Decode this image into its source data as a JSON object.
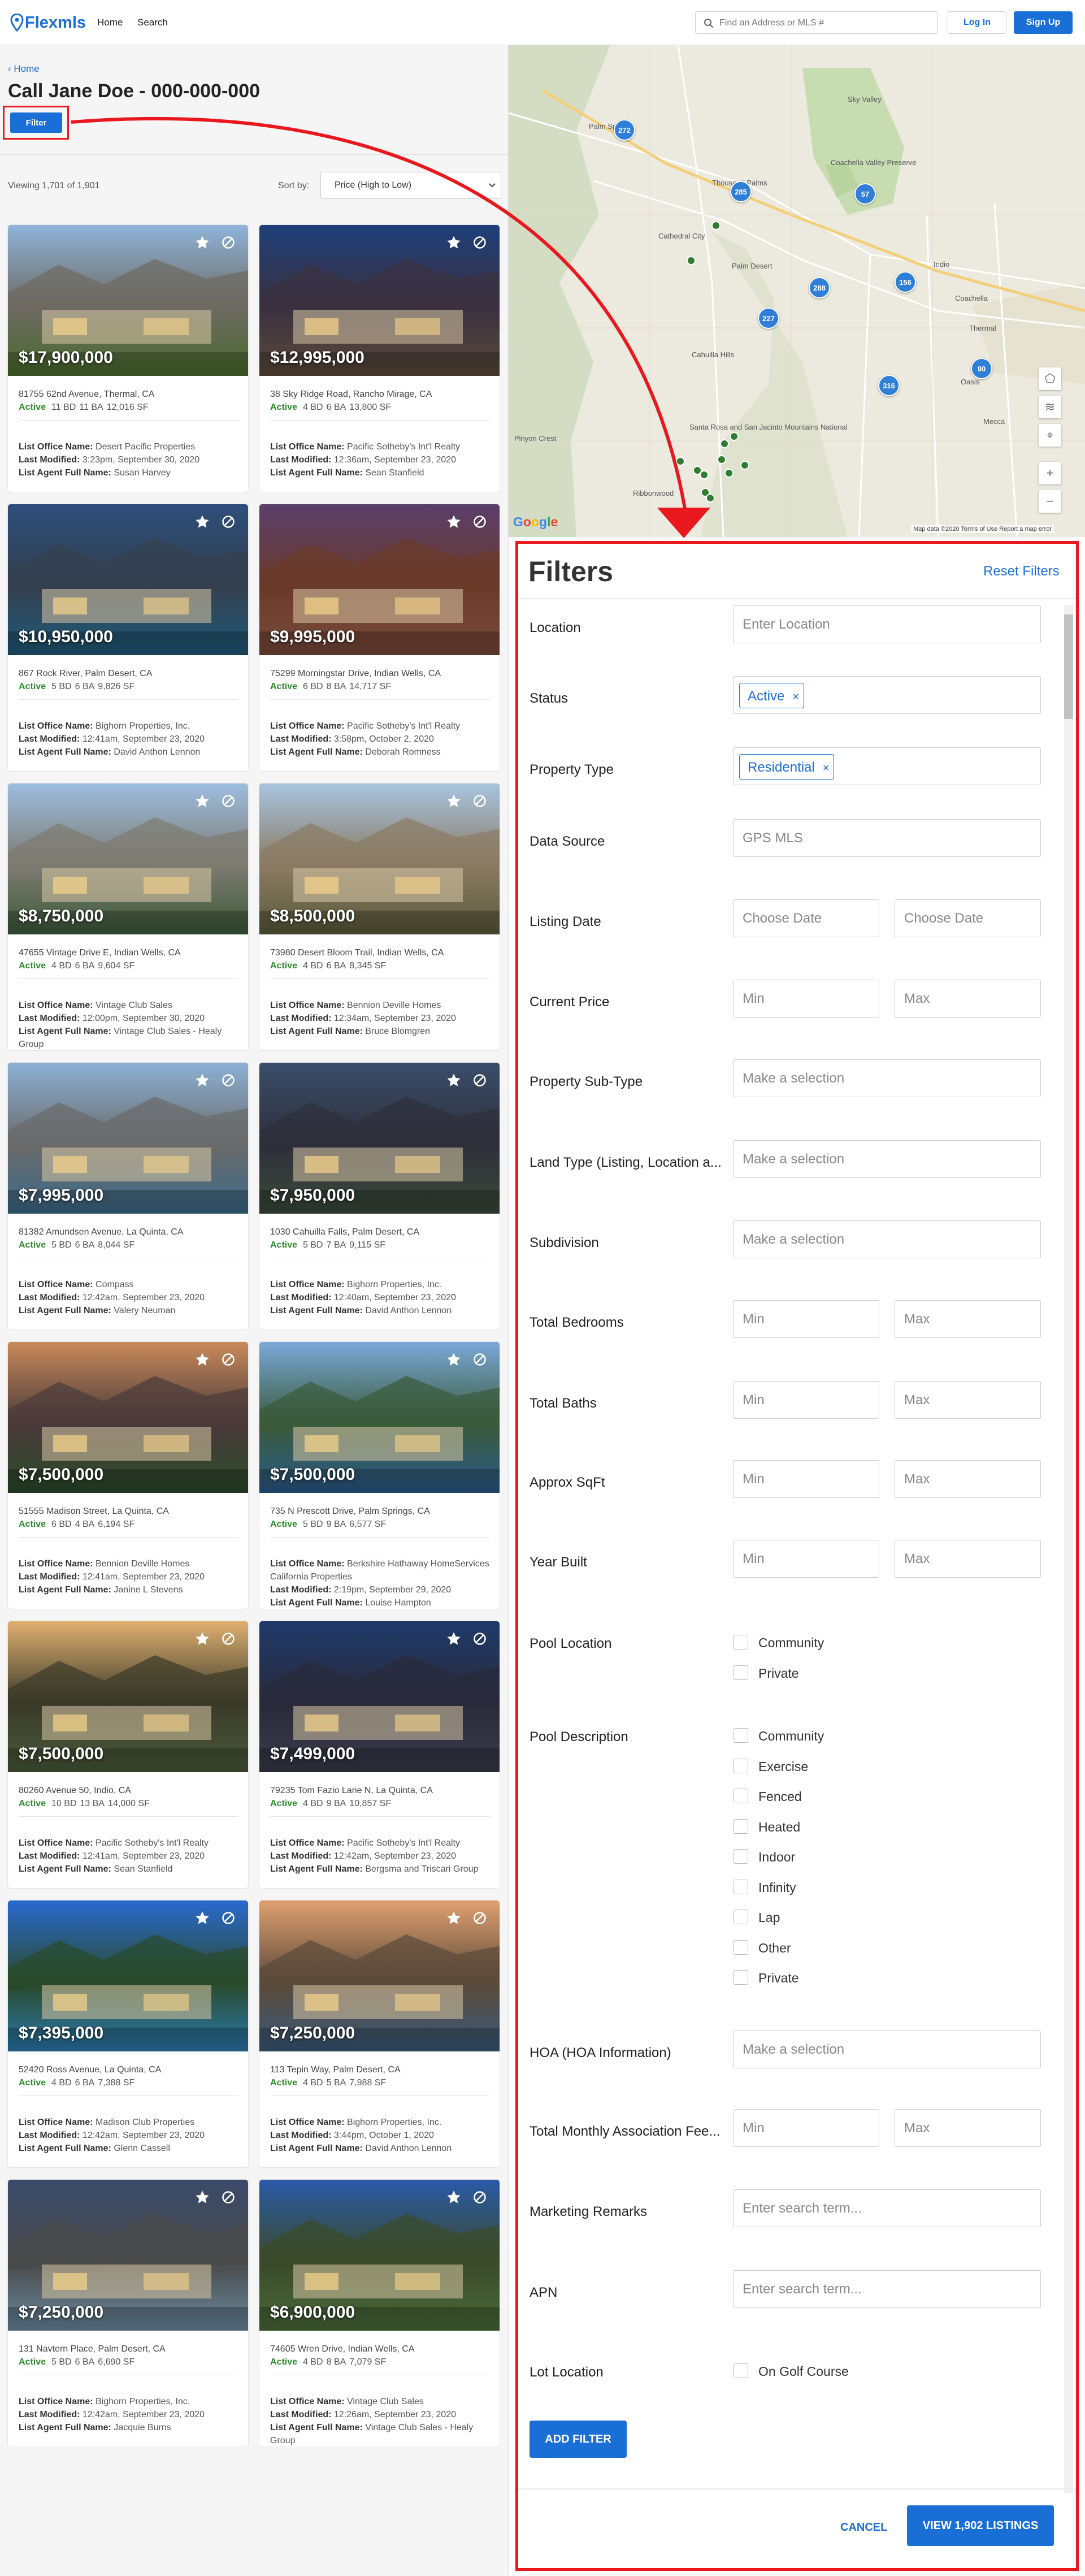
{
  "header": {
    "logo_text": "Flexmls",
    "nav": [
      "Home",
      "Search"
    ],
    "search_placeholder": "Find an Address or MLS #",
    "login": "Log In",
    "signup": "Sign Up"
  },
  "left": {
    "breadcrumb": "Home",
    "title": "Call Jane Doe - 000-000-000",
    "filter_button": "Filter",
    "viewing": "Viewing 1,701 of 1,901",
    "sort_label": "Sort by:",
    "sort_value": "Price (High to Low)"
  },
  "listings": [
    {
      "price": "$17,900,000",
      "address": "81755 62nd Avenue, Thermal, CA",
      "status": "Active",
      "bd": "11 BD",
      "ba": "11 BA",
      "sf": "12,016 SF",
      "office": "Desert Pacific Properties",
      "modified": "3:23pm, September 30, 2020",
      "agent": "Susan Harvey"
    },
    {
      "price": "$12,995,000",
      "address": "38 Sky Ridge Road, Rancho Mirage, CA",
      "status": "Active",
      "bd": "4 BD",
      "ba": "6 BA",
      "sf": "13,800 SF",
      "office": "Pacific Sotheby's Int'l Realty",
      "modified": "12:36am, September 23, 2020",
      "agent": "Sean Stanfield"
    },
    {
      "price": "$10,950,000",
      "address": "867 Rock River, Palm Desert, CA",
      "status": "Active",
      "bd": "5 BD",
      "ba": "6 BA",
      "sf": "9,826 SF",
      "office": "Bighorn Properties, Inc.",
      "modified": "12:41am, September 23, 2020",
      "agent": "David Anthon Lennon"
    },
    {
      "price": "$9,995,000",
      "address": "75299 Morningstar Drive, Indian Wells, CA",
      "status": "Active",
      "bd": "6 BD",
      "ba": "8 BA",
      "sf": "14,717 SF",
      "office": "Pacific Sotheby's Int'l Realty",
      "modified": "3:58pm, October 2, 2020",
      "agent": "Deborah Romness"
    },
    {
      "price": "$8,750,000",
      "address": "47655 Vintage Drive E, Indian Wells, CA",
      "status": "Active",
      "bd": "4 BD",
      "ba": "6 BA",
      "sf": "9,604 SF",
      "office": "Vintage Club Sales",
      "modified": "12:00pm, September 30, 2020",
      "agent": "Vintage Club Sales - Healy Group"
    },
    {
      "price": "$8,500,000",
      "address": "73980 Desert Bloom Trail, Indian Wells, CA",
      "status": "Active",
      "bd": "4 BD",
      "ba": "6 BA",
      "sf": "8,345 SF",
      "office": "Bennion Deville Homes",
      "modified": "12:34am, September 23, 2020",
      "agent": "Bruce Blomgren"
    },
    {
      "price": "$7,995,000",
      "address": "81382 Amundsen Avenue, La Quinta, CA",
      "status": "Active",
      "bd": "5 BD",
      "ba": "6 BA",
      "sf": "8,044 SF",
      "office": "Compass",
      "modified": "12:42am, September 23, 2020",
      "agent": "Valery Neuman"
    },
    {
      "price": "$7,950,000",
      "address": "1030 Cahuilla Falls, Palm Desert, CA",
      "status": "Active",
      "bd": "5 BD",
      "ba": "7 BA",
      "sf": "9,115 SF",
      "office": "Bighorn Properties, Inc.",
      "modified": "12:40am, September 23, 2020",
      "agent": "David Anthon Lennon"
    },
    {
      "price": "$7,500,000",
      "address": "51555 Madison Street, La Quinta, CA",
      "status": "Active",
      "bd": "6 BD",
      "ba": "4 BA",
      "sf": "6,194 SF",
      "office": "Bennion Deville Homes",
      "modified": "12:41am, September 23, 2020",
      "agent": "Janine L Stevens"
    },
    {
      "price": "$7,500,000",
      "address": "735 N Prescott Drive, Palm Springs, CA",
      "status": "Active",
      "bd": "5 BD",
      "ba": "9 BA",
      "sf": "6,577 SF",
      "office": "Berkshire Hathaway HomeServices California Properties",
      "modified": "2:19pm, September 29, 2020",
      "agent": "Louise Hampton"
    },
    {
      "price": "$7,500,000",
      "address": "80260 Avenue 50, Indio, CA",
      "status": "Active",
      "bd": "10 BD",
      "ba": "13 BA",
      "sf": "14,000 SF",
      "office": "Pacific Sotheby's Int'l Realty",
      "modified": "12:41am, September 23, 2020",
      "agent": "Sean Stanfield"
    },
    {
      "price": "$7,499,000",
      "address": "79235 Tom Fazio Lane N, La Quinta, CA",
      "status": "Active",
      "bd": "4 BD",
      "ba": "9 BA",
      "sf": "10,857 SF",
      "office": "Pacific Sotheby's Int'l Realty",
      "modified": "12:42am, September 23, 2020",
      "agent": "Bergsma and Triscari Group"
    },
    {
      "price": "$7,395,000",
      "address": "52420 Ross Avenue, La Quinta, CA",
      "status": "Active",
      "bd": "4 BD",
      "ba": "6 BA",
      "sf": "7,388 SF",
      "office": "Madison Club Properties",
      "modified": "12:42am, September 23, 2020",
      "agent": "Glenn Cassell"
    },
    {
      "price": "$7,250,000",
      "address": "113 Tepin Way, Palm Desert, CA",
      "status": "Active",
      "bd": "4 BD",
      "ba": "5 BA",
      "sf": "7,988 SF",
      "office": "Bighorn Properties, Inc.",
      "modified": "3:44pm, October 1, 2020",
      "agent": "David Anthon Lennon"
    },
    {
      "price": "$7,250,000",
      "address": "131 Navtern Place, Palm Desert, CA",
      "status": "Active",
      "bd": "5 BD",
      "ba": "6 BA",
      "sf": "6,690 SF",
      "office": "Bighorn Properties, Inc.",
      "modified": "12:42am, September 23, 2020",
      "agent": "Jacquie Burns"
    },
    {
      "price": "$6,900,000",
      "address": "74605 Wren Drive, Indian Wells, CA",
      "status": "Active",
      "bd": "4 BD",
      "ba": "8 BA",
      "sf": "7,079 SF",
      "office": "Vintage Club Sales",
      "modified": "12:26am, September 23, 2020",
      "agent": "Vintage Club Sales - Healy Group"
    }
  ],
  "card_labels": {
    "office": "List Office Name:",
    "modified": "Last Modified:",
    "agent": "List Agent Full Name:"
  },
  "map": {
    "clusters": [
      "272",
      "285",
      "57",
      "288",
      "156",
      "227",
      "90",
      "316"
    ],
    "places": [
      "Palm Springs",
      "Thousand Palms",
      "Cathedral City",
      "Coachella Valley Preserve",
      "Palm Desert",
      "Indio",
      "Cahuilla Hills",
      "Santa Rosa and San Jacinto Mountains National",
      "Coachella",
      "Thermal",
      "Oasis",
      "Mecca",
      "Pinyon Crest",
      "Sky Valley",
      "Ribbonwood"
    ],
    "attribution": "Map data ©2020   Terms of Use   Report a map error",
    "google": "Google"
  },
  "filters": {
    "title": "Filters",
    "reset": "Reset Filters",
    "location": {
      "label": "Location",
      "placeholder": "Enter Location"
    },
    "status": {
      "label": "Status",
      "chip": "Active"
    },
    "property_type": {
      "label": "Property Type",
      "chip": "Residential"
    },
    "data_source": {
      "label": "Data Source",
      "value": "GPS MLS"
    },
    "listing_date": {
      "label": "Listing Date",
      "from": "Choose Date",
      "to": "Choose Date"
    },
    "current_price": {
      "label": "Current Price",
      "min": "Min",
      "max": "Max"
    },
    "sub_type": {
      "label": "Property Sub-Type",
      "placeholder": "Make a selection"
    },
    "land_type": {
      "label": "Land Type (Listing, Location a...",
      "placeholder": "Make a selection"
    },
    "subdivision": {
      "label": "Subdivision",
      "placeholder": "Make a selection"
    },
    "bedrooms": {
      "label": "Total Bedrooms",
      "min": "Min",
      "max": "Max"
    },
    "baths": {
      "label": "Total Baths",
      "min": "Min",
      "max": "Max"
    },
    "sqft": {
      "label": "Approx SqFt",
      "min": "Min",
      "max": "Max"
    },
    "year_built": {
      "label": "Year Built",
      "min": "Min",
      "max": "Max"
    },
    "pool_location": {
      "label": "Pool Location",
      "options": [
        "Community",
        "Private"
      ]
    },
    "pool_description": {
      "label": "Pool Description",
      "options": [
        "Community",
        "Exercise",
        "Fenced",
        "Heated",
        "Indoor",
        "Infinity",
        "Lap",
        "Other",
        "Private"
      ]
    },
    "hoa": {
      "label": "HOA (HOA Information)",
      "placeholder": "Make a selection"
    },
    "assoc_fee": {
      "label": "Total Monthly Association Fee...",
      "min": "Min",
      "max": "Max"
    },
    "remarks": {
      "label": "Marketing Remarks",
      "placeholder": "Enter search term..."
    },
    "apn": {
      "label": "APN",
      "placeholder": "Enter search term..."
    },
    "lot_location": {
      "label": "Lot Location",
      "options": [
        "On Golf Course"
      ]
    },
    "add_filter": "ADD FILTER",
    "cancel": "CANCEL",
    "view": "VIEW 1,902 LISTINGS"
  },
  "colors": {
    "brand": "#1a6fd6",
    "active": "#2d8c2d",
    "highlight": "#e8181e"
  }
}
